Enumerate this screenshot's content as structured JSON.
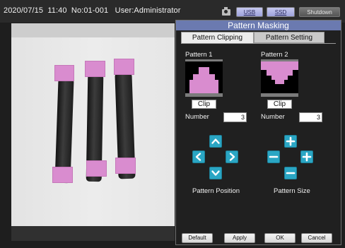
{
  "topbar": {
    "date": "2020/07/15",
    "time": "11:40",
    "number": "No:01-001",
    "user": "User:Administrator",
    "usb_label": "USB",
    "ssd_label": "SSD",
    "shutdown_label": "Shutdown"
  },
  "panel": {
    "title": "Pattern Masking",
    "tabs": [
      "Pattern Clipping",
      "Pattern Setting"
    ],
    "active_tab": "Pattern Clipping",
    "patterns": [
      {
        "label": "Pattern 1",
        "clip_label": "Clip",
        "number_label": "Number",
        "number_value": "3"
      },
      {
        "label": "Pattern 2",
        "clip_label": "Clip",
        "number_label": "Number",
        "number_value": "3"
      }
    ],
    "position_label": "Pattern Position",
    "size_label": "Pattern Size",
    "buttons": {
      "default": "Default",
      "apply": "Apply",
      "ok": "OK",
      "cancel": "Cancel"
    }
  },
  "colors": {
    "mask": "#d98ccf",
    "accent": "#2aa6c4",
    "title_bar": "#6b7ab0"
  }
}
